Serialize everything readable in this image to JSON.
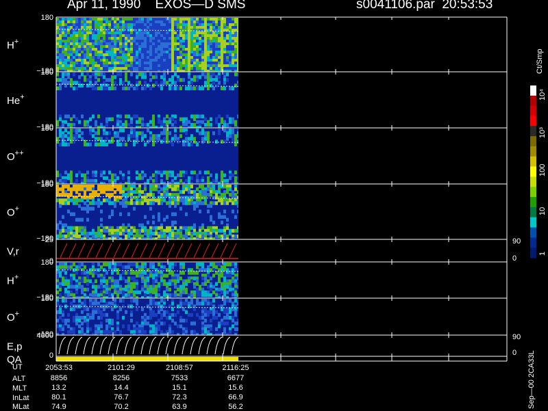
{
  "header": {
    "title": "Apr 11, 1990    EXOS—D SMS",
    "file": "s0041106.par  20:53:53"
  },
  "chart_data": {
    "type": "heatmap",
    "panels": [
      {
        "label_base": "H",
        "label_sup": "+",
        "ytop": "180",
        "ybot": "−180"
      },
      {
        "label_base": "He",
        "label_sup": "+",
        "ytop": "180",
        "ybot": "−180"
      },
      {
        "label_base": "O",
        "label_sup": "++",
        "ytop": "180",
        "ybot": "−180"
      },
      {
        "label_base": "O",
        "label_sup": "+",
        "ytop": "180",
        "ybot": "−180"
      },
      {
        "label_base": "V,r",
        "label_sup": "",
        "ytop": "25",
        "ybot": "0",
        "right_top": "90",
        "right_bot": "0"
      },
      {
        "label_base": "H",
        "label_sup": "+",
        "ytop": "180",
        "ybot": "−180"
      },
      {
        "label_base": "O",
        "label_sup": "+",
        "ytop": "180",
        "ybot": "−180"
      },
      {
        "label_base": "E,p",
        "label_sup": "",
        "ytop": "4000",
        "ybot": "0",
        "right_top": "90",
        "right_bot": "0"
      },
      {
        "label_base": "QA",
        "label_sup": "",
        "ytop": "",
        "ybot": ""
      }
    ],
    "colorbar": {
      "unit": "Ct/Smp",
      "ticks": [
        "10⁴",
        "10³",
        "100",
        "10",
        "1"
      ],
      "colors": [
        "#ffffff",
        "#b00000",
        "#d40000",
        "#ff0000",
        "#2a2a2a",
        "#7a6a00",
        "#a08a00",
        "#d4c000",
        "#ffff00",
        "#c8e000",
        "#7cd000",
        "#20a000",
        "#007a40",
        "#00c8c8",
        "#0050b0",
        "#002a90",
        "#001a70"
      ]
    },
    "footer": {
      "rows": [
        {
          "name": "UT",
          "values": [
            "2053:53",
            "2101:29",
            "2108:57",
            "2116:25"
          ]
        },
        {
          "name": "ALT",
          "values": [
            "8856",
            "8256",
            "7533",
            "6677"
          ]
        },
        {
          "name": "MLT",
          "values": [
            "13.2",
            "14.4",
            "15.1",
            "15.6"
          ]
        },
        {
          "name": "InLat",
          "values": [
            "80.1",
            "76.7",
            "72.3",
            "66.9"
          ]
        },
        {
          "name": "MLat",
          "values": [
            "74.9",
            "70.2",
            "63.9",
            "56.2"
          ]
        }
      ],
      "stamp": "Sep—00 2CA33L"
    }
  }
}
